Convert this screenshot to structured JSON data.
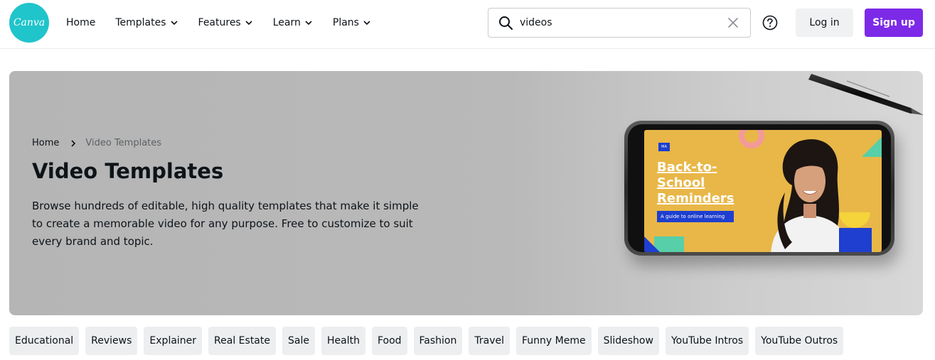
{
  "header": {
    "logo_text": "Canva",
    "nav": [
      {
        "label": "Home",
        "dropdown": false
      },
      {
        "label": "Templates",
        "dropdown": true
      },
      {
        "label": "Features",
        "dropdown": true
      },
      {
        "label": "Learn",
        "dropdown": true
      },
      {
        "label": "Plans",
        "dropdown": true
      }
    ],
    "search": {
      "value": "videos"
    },
    "login_label": "Log in",
    "signup_label": "Sign up"
  },
  "hero": {
    "breadcrumb": {
      "home": "Home",
      "current": "Video Templates"
    },
    "title": "Video Templates",
    "description": "Browse hundreds of editable, high quality templates that make it simple to create a memorable video for any purpose. Free to customize to suit every brand and topic.",
    "preview": {
      "badge": "MA",
      "title": "Back-to-School Reminders",
      "subtitle": "A guide to online learning"
    }
  },
  "tags": [
    "Educational",
    "Reviews",
    "Explainer",
    "Real Estate",
    "Sale",
    "Health",
    "Food",
    "Fashion",
    "Travel",
    "Funny Meme",
    "Slideshow",
    "YouTube Intros",
    "YouTube Outros"
  ],
  "colors": {
    "brand": "#20c4cb",
    "signup": "#7d2ae8",
    "preview_bg": "#e8b748",
    "preview_accent": "#1e3fcf"
  }
}
